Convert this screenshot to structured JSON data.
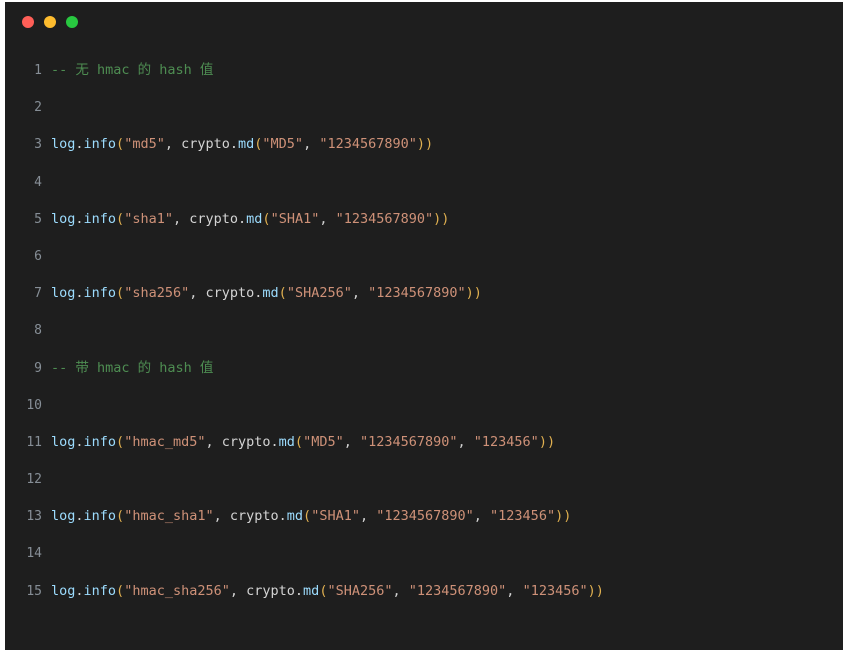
{
  "window": {
    "background_color": "#1e1e1e",
    "controls": [
      {
        "name": "close",
        "color": "#ff5f57"
      },
      {
        "name": "minimize",
        "color": "#febc2e"
      },
      {
        "name": "maximize",
        "color": "#28c840"
      }
    ]
  },
  "editor": {
    "language": "lua",
    "theme": "dark",
    "colors": {
      "comment": "#4e8d52",
      "variable": "#9cdcfe",
      "string": "#ce9178",
      "paren": "#e0b050",
      "plain": "#d4d4d4",
      "line_number": "#868e96"
    },
    "lines": [
      {
        "number": "1",
        "text": "-- 无 hmac 的 hash 值",
        "tokens": [
          {
            "t": "-- 无 hmac 的 hash 值",
            "c": "comment"
          }
        ]
      },
      {
        "number": "2",
        "text": "",
        "tokens": []
      },
      {
        "number": "3",
        "text": "log.info(\"md5\", crypto.md(\"MD5\", \"1234567890\"))",
        "tokens": [
          {
            "t": "log",
            "c": "var"
          },
          {
            "t": ".",
            "c": "plain"
          },
          {
            "t": "info",
            "c": "var"
          },
          {
            "t": "(",
            "c": "paren"
          },
          {
            "t": "\"md5\"",
            "c": "string"
          },
          {
            "t": ", ",
            "c": "plain"
          },
          {
            "t": "crypto",
            "c": "plain"
          },
          {
            "t": ".",
            "c": "plain"
          },
          {
            "t": "md",
            "c": "var"
          },
          {
            "t": "(",
            "c": "paren"
          },
          {
            "t": "\"MD5\"",
            "c": "string"
          },
          {
            "t": ", ",
            "c": "plain"
          },
          {
            "t": "\"1234567890\"",
            "c": "string"
          },
          {
            "t": "))",
            "c": "paren"
          }
        ]
      },
      {
        "number": "4",
        "text": "",
        "tokens": []
      },
      {
        "number": "5",
        "text": "log.info(\"sha1\", crypto.md(\"SHA1\", \"1234567890\"))",
        "tokens": [
          {
            "t": "log",
            "c": "var"
          },
          {
            "t": ".",
            "c": "plain"
          },
          {
            "t": "info",
            "c": "var"
          },
          {
            "t": "(",
            "c": "paren"
          },
          {
            "t": "\"sha1\"",
            "c": "string"
          },
          {
            "t": ", ",
            "c": "plain"
          },
          {
            "t": "crypto",
            "c": "plain"
          },
          {
            "t": ".",
            "c": "plain"
          },
          {
            "t": "md",
            "c": "var"
          },
          {
            "t": "(",
            "c": "paren"
          },
          {
            "t": "\"SHA1\"",
            "c": "string"
          },
          {
            "t": ", ",
            "c": "plain"
          },
          {
            "t": "\"1234567890\"",
            "c": "string"
          },
          {
            "t": "))",
            "c": "paren"
          }
        ]
      },
      {
        "number": "6",
        "text": "",
        "tokens": []
      },
      {
        "number": "7",
        "text": "log.info(\"sha256\", crypto.md(\"SHA256\", \"1234567890\"))",
        "tokens": [
          {
            "t": "log",
            "c": "var"
          },
          {
            "t": ".",
            "c": "plain"
          },
          {
            "t": "info",
            "c": "var"
          },
          {
            "t": "(",
            "c": "paren"
          },
          {
            "t": "\"sha256\"",
            "c": "string"
          },
          {
            "t": ", ",
            "c": "plain"
          },
          {
            "t": "crypto",
            "c": "plain"
          },
          {
            "t": ".",
            "c": "plain"
          },
          {
            "t": "md",
            "c": "var"
          },
          {
            "t": "(",
            "c": "paren"
          },
          {
            "t": "\"SHA256\"",
            "c": "string"
          },
          {
            "t": ", ",
            "c": "plain"
          },
          {
            "t": "\"1234567890\"",
            "c": "string"
          },
          {
            "t": "))",
            "c": "paren"
          }
        ]
      },
      {
        "number": "8",
        "text": "",
        "tokens": []
      },
      {
        "number": "9",
        "text": "-- 带 hmac 的 hash 值",
        "tokens": [
          {
            "t": "-- 带 hmac 的 hash 值",
            "c": "comment"
          }
        ]
      },
      {
        "number": "10",
        "text": "",
        "tokens": []
      },
      {
        "number": "11",
        "text": "log.info(\"hmac_md5\", crypto.md(\"MD5\", \"1234567890\", \"123456\"))",
        "tokens": [
          {
            "t": "log",
            "c": "var"
          },
          {
            "t": ".",
            "c": "plain"
          },
          {
            "t": "info",
            "c": "var"
          },
          {
            "t": "(",
            "c": "paren"
          },
          {
            "t": "\"hmac_md5\"",
            "c": "string"
          },
          {
            "t": ", ",
            "c": "plain"
          },
          {
            "t": "crypto",
            "c": "plain"
          },
          {
            "t": ".",
            "c": "plain"
          },
          {
            "t": "md",
            "c": "var"
          },
          {
            "t": "(",
            "c": "paren"
          },
          {
            "t": "\"MD5\"",
            "c": "string"
          },
          {
            "t": ", ",
            "c": "plain"
          },
          {
            "t": "\"1234567890\"",
            "c": "string"
          },
          {
            "t": ", ",
            "c": "plain"
          },
          {
            "t": "\"123456\"",
            "c": "string"
          },
          {
            "t": "))",
            "c": "paren"
          }
        ]
      },
      {
        "number": "12",
        "text": "",
        "tokens": []
      },
      {
        "number": "13",
        "text": "log.info(\"hmac_sha1\", crypto.md(\"SHA1\", \"1234567890\", \"123456\"))",
        "tokens": [
          {
            "t": "log",
            "c": "var"
          },
          {
            "t": ".",
            "c": "plain"
          },
          {
            "t": "info",
            "c": "var"
          },
          {
            "t": "(",
            "c": "paren"
          },
          {
            "t": "\"hmac_sha1\"",
            "c": "string"
          },
          {
            "t": ", ",
            "c": "plain"
          },
          {
            "t": "crypto",
            "c": "plain"
          },
          {
            "t": ".",
            "c": "plain"
          },
          {
            "t": "md",
            "c": "var"
          },
          {
            "t": "(",
            "c": "paren"
          },
          {
            "t": "\"SHA1\"",
            "c": "string"
          },
          {
            "t": ", ",
            "c": "plain"
          },
          {
            "t": "\"1234567890\"",
            "c": "string"
          },
          {
            "t": ", ",
            "c": "plain"
          },
          {
            "t": "\"123456\"",
            "c": "string"
          },
          {
            "t": "))",
            "c": "paren"
          }
        ]
      },
      {
        "number": "14",
        "text": "",
        "tokens": []
      },
      {
        "number": "15",
        "text": "log.info(\"hmac_sha256\", crypto.md(\"SHA256\", \"1234567890\", \"123456\"))",
        "tokens": [
          {
            "t": "log",
            "c": "var"
          },
          {
            "t": ".",
            "c": "plain"
          },
          {
            "t": "info",
            "c": "var"
          },
          {
            "t": "(",
            "c": "paren"
          },
          {
            "t": "\"hmac_sha256\"",
            "c": "string"
          },
          {
            "t": ", ",
            "c": "plain"
          },
          {
            "t": "crypto",
            "c": "plain"
          },
          {
            "t": ".",
            "c": "plain"
          },
          {
            "t": "md",
            "c": "var"
          },
          {
            "t": "(",
            "c": "paren"
          },
          {
            "t": "\"SHA256\"",
            "c": "string"
          },
          {
            "t": ", ",
            "c": "plain"
          },
          {
            "t": "\"1234567890\"",
            "c": "string"
          },
          {
            "t": ", ",
            "c": "plain"
          },
          {
            "t": "\"123456\"",
            "c": "string"
          },
          {
            "t": "))",
            "c": "paren"
          }
        ]
      }
    ]
  }
}
